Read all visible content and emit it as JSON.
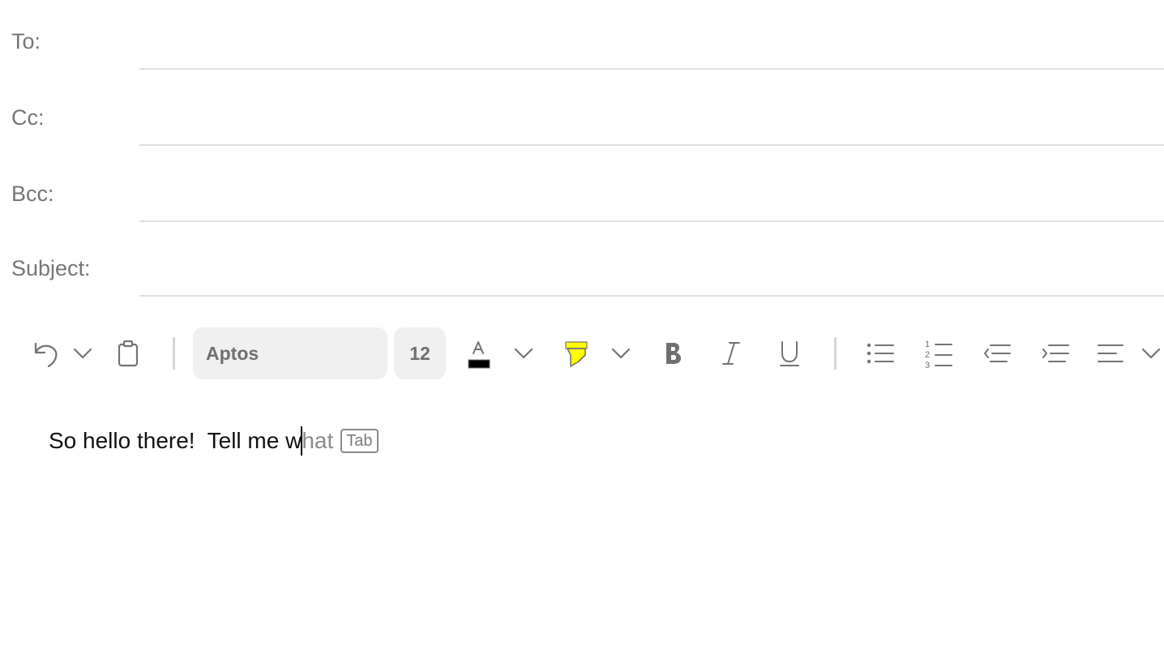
{
  "header": {
    "to_label": "To:",
    "cc_label": "Cc:",
    "bcc_label": "Bcc:",
    "subject_label": "Subject:",
    "to_value": "",
    "cc_value": "",
    "bcc_value": "",
    "subject_value": ""
  },
  "toolbar": {
    "font_name": "Aptos",
    "font_size": "12",
    "font_color": "#000000",
    "highlight_color": "#ffff00",
    "icons": [
      "undo-icon",
      "chevron-down-icon",
      "clipboard-icon",
      "font-color-icon",
      "highlighter-icon",
      "bold-icon",
      "italic-icon",
      "underline-icon",
      "bullet-list-icon",
      "numbered-list-icon",
      "decrease-indent-icon",
      "increase-indent-icon",
      "align-left-icon"
    ]
  },
  "body": {
    "typed_text": "So hello there!  Tell me w",
    "suggestion_text": "hat",
    "tab_hint": "Tab"
  }
}
